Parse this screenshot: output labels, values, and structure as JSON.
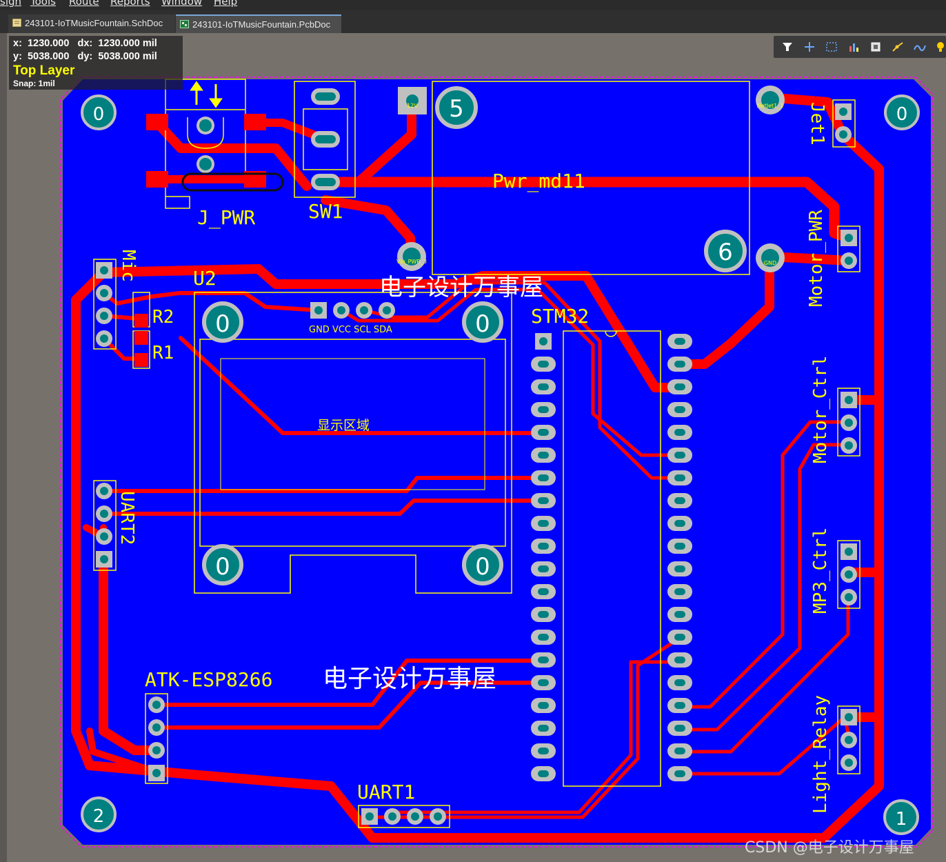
{
  "menu": {
    "items": [
      "sign",
      "Tools",
      "Route",
      "Reports",
      "Window",
      "Help"
    ]
  },
  "tabs": [
    {
      "label": "243101-IoTMusicFountain.SchDoc",
      "icon": "schematic-doc-icon"
    },
    {
      "label": "243101-IoTMusicFountain.PcbDoc",
      "icon": "pcb-doc-icon",
      "active": true
    }
  ],
  "coords": {
    "x_line": "x:  1230.000   dx:  1230.000 mil",
    "y_line": "y:  5038.000   dy:  5038.000 mil",
    "layer": "Top Layer",
    "snap": "Snap: 1mil"
  },
  "toolbar": {
    "icons": [
      "filter-icon",
      "cross-probe-icon",
      "select-rect-icon",
      "chart-icon",
      "component-icon",
      "route-icon",
      "interactive-route-icon",
      "bulb-icon"
    ]
  },
  "designators": {
    "j_pwr": "J_PWR",
    "sw1": "SW1",
    "pwr_md": "Pwr_md11",
    "u2": "U2",
    "stm32": "STM32",
    "mic": "Mic",
    "r2": "R2",
    "r1": "R1",
    "uart2": "UART2",
    "uart1": "UART1",
    "esp": "ATK-ESP8266",
    "jet1": "Jet1",
    "motor_pwr": "Motor_PWR",
    "motor_ctrl": "Motor_Ctrl",
    "mp3_ctrl": "MP3_Ctrl",
    "light_relay": "Light_Relay"
  },
  "pad_labels": {
    "oled_pins": "GND VCC SCL SDA",
    "pwr_12v": "12V",
    "pwr_vin": "Vin_PWR_3",
    "jet_net": "NetJet1_1",
    "gnd": "GND",
    "display_area": "显示区域"
  },
  "mount_holes": {
    "h0": "0",
    "h1": "1",
    "h2": "2",
    "h5": "5",
    "h6": "6"
  },
  "watermarks": {
    "main": "电子设计万事屋",
    "csdn": "CSDN @电子设计万事屋"
  },
  "colors": {
    "board": "#0000ff",
    "trace": "#ff0000",
    "silk": "#ffff00",
    "pad": "#c0c0c0",
    "via": "#008080",
    "bg": "#76716b"
  }
}
